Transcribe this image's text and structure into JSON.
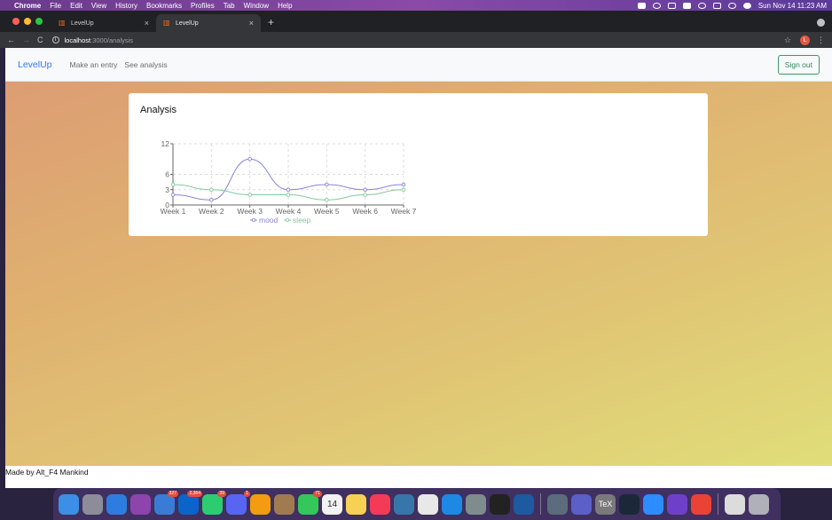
{
  "menubar": {
    "apple": "",
    "items": [
      "Chrome",
      "File",
      "Edit",
      "View",
      "History",
      "Bookmarks",
      "Profiles",
      "Tab",
      "Window",
      "Help"
    ],
    "datetime": "Sun Nov 14  11:23 AM"
  },
  "browser": {
    "tabs": [
      {
        "title": "LevelUp",
        "active": false
      },
      {
        "title": "LevelUp",
        "active": true
      }
    ],
    "new_tab": "+",
    "url_host": "localhost",
    "url_path": ":3000/analysis",
    "profile_initial": "L"
  },
  "app": {
    "brand": "LevelUp",
    "nav": [
      "Make an entry",
      "See analysis"
    ],
    "sign_out": "Sign out",
    "card_title": "Analysis",
    "footer": "Made by Alt_F4 Mankind"
  },
  "chart_data": {
    "type": "line",
    "categories": [
      "Week 1",
      "Week 2",
      "Week 3",
      "Week 4",
      "Week 5",
      "Week 6",
      "Week 7"
    ],
    "series": [
      {
        "name": "mood",
        "values": [
          2,
          1,
          9,
          3,
          4,
          3,
          4
        ],
        "color": "#8884d8"
      },
      {
        "name": "sleep",
        "values": [
          4,
          3,
          2,
          2,
          1,
          2,
          3
        ],
        "color": "#82ca9d"
      }
    ],
    "yticks": [
      0,
      3,
      6,
      12
    ],
    "ylim": [
      0,
      12
    ],
    "grid": true,
    "legend": "bottom-center",
    "smooth": true
  },
  "dock": {
    "apps": [
      {
        "name": "finder",
        "color": "#3b8fe6"
      },
      {
        "name": "launchpad",
        "color": "#8c8c9a"
      },
      {
        "name": "safari",
        "color": "#2d7de0"
      },
      {
        "name": "podcasts",
        "color": "#8e44ad"
      },
      {
        "name": "mail",
        "color": "#3a7bd5",
        "badge": "327"
      },
      {
        "name": "outlook",
        "color": "#0a64c9",
        "badge": "2,364"
      },
      {
        "name": "facetime",
        "color": "#2ecc71",
        "badge": "39"
      },
      {
        "name": "discord",
        "color": "#5865f2",
        "badge": "1"
      },
      {
        "name": "sublime",
        "color": "#f39c12"
      },
      {
        "name": "contacts",
        "color": "#a07b50"
      },
      {
        "name": "messages",
        "color": "#34c759",
        "badge": "71"
      },
      {
        "name": "calendar",
        "color": "#f2f2f2",
        "label": "14"
      },
      {
        "name": "notes",
        "color": "#f7d154"
      },
      {
        "name": "music",
        "color": "#f33b57"
      },
      {
        "name": "python",
        "color": "#3776ab"
      },
      {
        "name": "textedit",
        "color": "#e8e8e8"
      },
      {
        "name": "vscode",
        "color": "#1e88e5"
      },
      {
        "name": "settings",
        "color": "#7f8c8d"
      },
      {
        "name": "terminal",
        "color": "#222222"
      },
      {
        "name": "virtualbox",
        "color": "#1d5a9f"
      },
      {
        "name": "preview",
        "color": "#5b6c7d"
      },
      {
        "name": "teams",
        "color": "#5b5fc7"
      },
      {
        "name": "tex",
        "color": "#7a7a7a",
        "label": "TeX"
      },
      {
        "name": "steam",
        "color": "#1b2838"
      },
      {
        "name": "zoom",
        "color": "#2d8cff"
      },
      {
        "name": "github",
        "color": "#6e40c9"
      },
      {
        "name": "chrome",
        "color": "#ea4335"
      },
      {
        "name": "documents",
        "color": "#dcdcdc"
      },
      {
        "name": "trash",
        "color": "#b0b0b8"
      }
    ]
  }
}
